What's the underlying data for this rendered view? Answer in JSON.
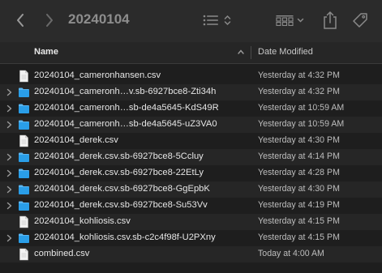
{
  "window": {
    "title": "20240104"
  },
  "columns": {
    "name": "Name",
    "date_modified": "Date Modified"
  },
  "files": [
    {
      "name": "20240104_cameronhansen.csv",
      "date": "Yesterday at 4:32 PM",
      "kind": "document",
      "expandable": false
    },
    {
      "name": "20240104_cameronh…v.sb-6927bce8-Zti34h",
      "date": "Yesterday at 4:32 PM",
      "kind": "folder",
      "expandable": true
    },
    {
      "name": "20240104_cameronh…sb-de4a5645-KdS49R",
      "date": "Yesterday at 10:59 AM",
      "kind": "folder",
      "expandable": true
    },
    {
      "name": "20240104_cameronh…sb-de4a5645-uZ3VA0",
      "date": "Yesterday at 10:59 AM",
      "kind": "folder",
      "expandable": true
    },
    {
      "name": "20240104_derek.csv",
      "date": "Yesterday at 4:30 PM",
      "kind": "document",
      "expandable": false
    },
    {
      "name": "20240104_derek.csv.sb-6927bce8-5Ccluy",
      "date": "Yesterday at 4:14 PM",
      "kind": "folder",
      "expandable": true
    },
    {
      "name": "20240104_derek.csv.sb-6927bce8-22EtLy",
      "date": "Yesterday at 4:28 PM",
      "kind": "folder",
      "expandable": true
    },
    {
      "name": "20240104_derek.csv.sb-6927bce8-GgEpbK",
      "date": "Yesterday at 4:30 PM",
      "kind": "folder",
      "expandable": true
    },
    {
      "name": "20240104_derek.csv.sb-6927bce8-Su53Vv",
      "date": "Yesterday at 4:19 PM",
      "kind": "folder",
      "expandable": true
    },
    {
      "name": "20240104_kohliosis.csv",
      "date": "Yesterday at 4:15 PM",
      "kind": "document",
      "expandable": false
    },
    {
      "name": "20240104_kohliosis.csv.sb-c2c4f98f-U2PXny",
      "date": "Yesterday at 4:15 PM",
      "kind": "folder",
      "expandable": true
    },
    {
      "name": "combined.csv",
      "date": "Today at 4:00 AM",
      "kind": "document",
      "expandable": false
    }
  ],
  "colors": {
    "folder": "#2a9ee8",
    "background": "#1e1e1e",
    "stripe": "#262626"
  }
}
